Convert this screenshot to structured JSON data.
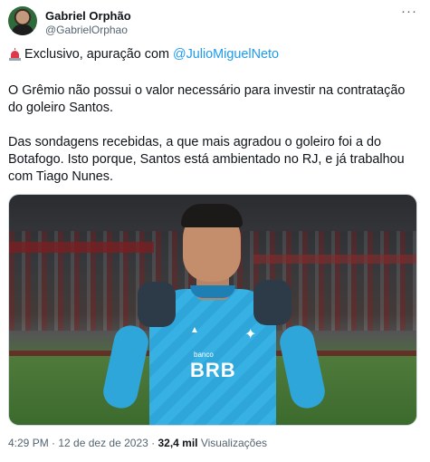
{
  "author": {
    "name": "Gabriel Orphão",
    "handle": "@GabrielOrphao",
    "avatar_icon": "profile-photo"
  },
  "more_icon": "more-dots-icon",
  "tweet": {
    "line1_prefix": "Exclusivo, apuração com ",
    "line1_mention": "@JulioMiguelNeto",
    "line1_icon": "police-siren-emoji",
    "paragraph1": "O Grêmio não possui o valor necessário para investir na contratação do goleiro Santos.",
    "paragraph2": "Das sondagens recebidas, a que mais agradou o goleiro foi a do Botafogo. Isto porque, Santos está ambientado no RJ, e já trabalhou com Tiago Nunes."
  },
  "media": {
    "sponsor_small": "banco",
    "sponsor_big": "BRB"
  },
  "meta": {
    "time": "4:29 PM",
    "separator1": " · ",
    "date": "12 de dez de 2023",
    "separator2": " · ",
    "views_count": "32,4 mil",
    "views_label": " Visualizações"
  },
  "colors": {
    "text": "#0f1419",
    "secondary": "#536471",
    "link": "#1d9bf0"
  }
}
